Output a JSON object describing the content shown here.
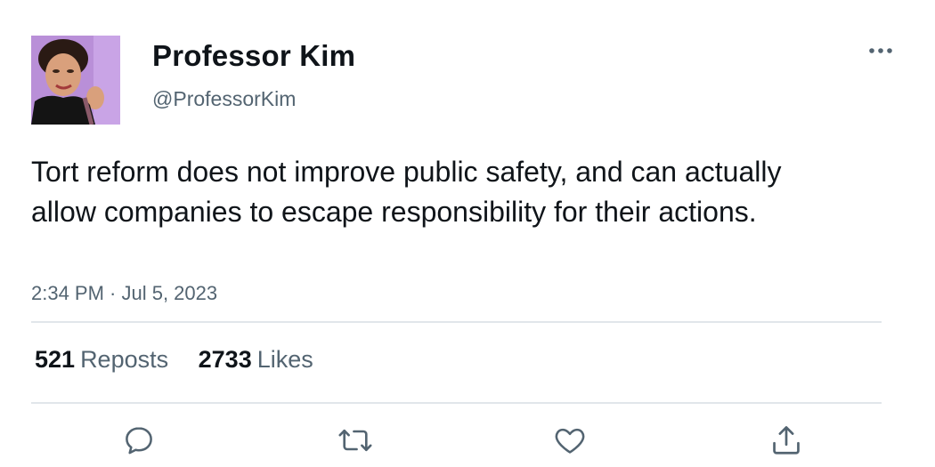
{
  "author": {
    "display_name": "Professor Kim",
    "handle": "@ProfessorKim"
  },
  "tweet": {
    "text": "Tort reform does not improve public safety, and can actually allow companies to escape responsibility for their actions.",
    "timestamp": "2:34 PM · Jul 5, 2023"
  },
  "stats": {
    "reposts_count": "521",
    "reposts_label": "Reposts",
    "likes_count": "2733",
    "likes_label": "Likes"
  },
  "icons": {
    "more": "more-horizontal-icon",
    "reply": "reply-icon",
    "repost": "repost-icon",
    "like": "heart-icon",
    "share": "share-icon"
  },
  "colors": {
    "text": "#0f1419",
    "secondary": "#536471",
    "divider": "#e1e6ea",
    "avatar_bg": "#b98fd8"
  }
}
